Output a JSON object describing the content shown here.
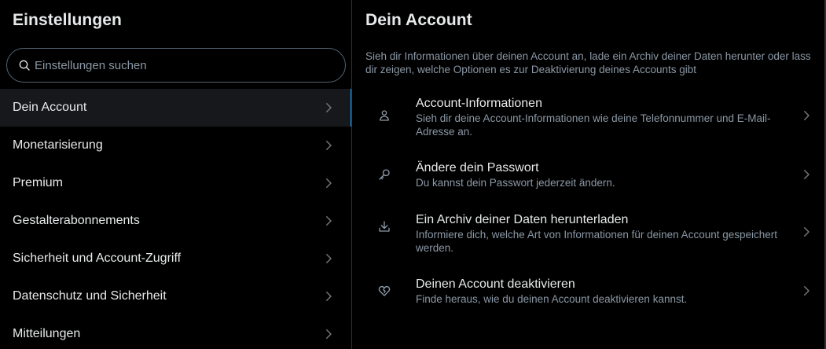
{
  "left": {
    "title": "Einstellungen",
    "search": {
      "placeholder": "Einstellungen suchen",
      "icon": "search-icon"
    },
    "items": [
      {
        "label": "Dein Account",
        "active": true
      },
      {
        "label": "Monetarisierung"
      },
      {
        "label": "Premium"
      },
      {
        "label": "Gestalterabonnements"
      },
      {
        "label": "Sicherheit und Account-Zugriff"
      },
      {
        "label": "Datenschutz und Sicherheit"
      },
      {
        "label": "Mitteilungen"
      }
    ]
  },
  "right": {
    "title": "Dein Account",
    "description": "Sieh dir Informationen über deinen Account an, lade ein Archiv deiner Daten herunter oder lass dir zeigen, welche Optionen es zur Deaktivierung deines Accounts gibt",
    "options": [
      {
        "title": "Account-Informationen",
        "subtitle": "Sieh dir deine Account-Informationen wie deine Telefonnummer und E-Mail-Adresse an.",
        "icon": "person-icon"
      },
      {
        "title": "Ändere dein Passwort",
        "subtitle": "Du kannst dein Passwort jederzeit ändern.",
        "icon": "key-icon"
      },
      {
        "title": "Ein Archiv deiner Daten herunterladen",
        "subtitle": "Informiere dich, welche Art von Informationen für deinen Account gespeichert werden.",
        "icon": "download-icon"
      },
      {
        "title": "Deinen Account deaktivieren",
        "subtitle": "Finde heraus, wie du deinen Account deaktivieren kannst.",
        "icon": "broken-heart-icon"
      }
    ]
  },
  "colors": {
    "background": "#000000",
    "text": "#e7e9ea",
    "secondary_text": "#8b98a5",
    "accent": "#1d9bf0",
    "active_bg": "#16181c",
    "border": "#2f3336"
  }
}
